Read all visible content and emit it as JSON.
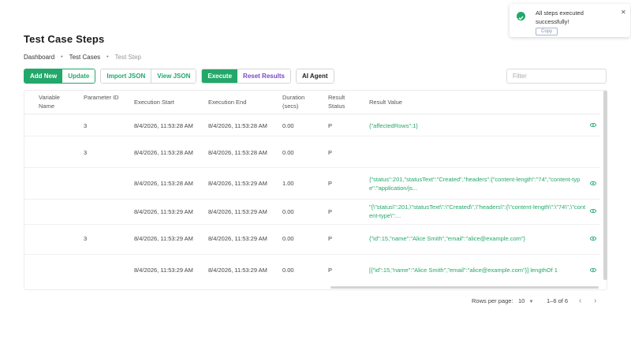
{
  "page": {
    "title": "Test Case Steps"
  },
  "breadcrumb": {
    "items": [
      "Dashboard",
      "Test Cases",
      "Test Step"
    ]
  },
  "toolbar": {
    "add_new": "Add New",
    "update": "Update",
    "import_json": "Import JSON",
    "view_json": "View JSON",
    "execute": "Execute",
    "reset_results": "Reset Results",
    "ai_agent": "AI Agent"
  },
  "filter": {
    "placeholder": "Filter",
    "value": ""
  },
  "table": {
    "headers": {
      "variable_name": "Variable Name",
      "parameter_id": "Parameter ID",
      "execution_start": "Execution Start",
      "execution_end": "Execution End",
      "duration": "Duration (secs)",
      "result_status": "Result Status",
      "result_value": "Result Value"
    },
    "rows": [
      {
        "parameter_id": "3",
        "execution_start": "8/4/2026, 11:53:28 AM",
        "execution_end": "8/4/2026, 11:53:28 AM",
        "duration": "0.00",
        "status": "P",
        "result": "{\"affectedRows\":1}",
        "has_view": true
      },
      {
        "parameter_id": "3",
        "execution_start": "8/4/2026, 11:53:28 AM",
        "execution_end": "8/4/2026, 11:53:28 AM",
        "duration": "0.00",
        "status": "P",
        "result": "",
        "has_view": false
      },
      {
        "parameter_id": "",
        "execution_start": "8/4/2026, 11:53:28 AM",
        "execution_end": "8/4/2026, 11:53:29 AM",
        "duration": "1.00",
        "status": "P",
        "result": "{\"status\":201,\"statusText\":\"Created\",\"headers\":{\"content-length\":\"74\",\"content-type\":\"application/js...",
        "has_view": true
      },
      {
        "parameter_id": "",
        "execution_start": "8/4/2026, 11:53:29 AM",
        "execution_end": "8/4/2026, 11:53:29 AM",
        "duration": "0.00",
        "status": "P",
        "result": "\"{\\\"status\\\":201,\\\"statusText\\\":\\\"Created\\\",\\\"headers\\\":{\\\"content-length\\\":\\\"74\\\",\\\"content-type\\\":...",
        "has_view": true
      },
      {
        "parameter_id": "3",
        "execution_start": "8/4/2026, 11:53:29 AM",
        "execution_end": "8/4/2026, 11:53:29 AM",
        "duration": "0.00",
        "status": "P",
        "result": "{\"id\":15,\"name\":\"Alice Smith\",\"email\":\"alice@example.com\"}",
        "has_view": true
      },
      {
        "parameter_id": "",
        "execution_start": "8/4/2026, 11:53:29 AM",
        "execution_end": "8/4/2026, 11:53:29 AM",
        "duration": "0.00",
        "status": "P",
        "result": "[{\"id\":15,\"name\":\"Alice Smith\",\"email\":\"alice@example.com\"}] lengthOf 1",
        "has_view": true
      }
    ]
  },
  "pagination": {
    "rows_per_page_label": "Rows per page:",
    "rows_per_page": "10",
    "range": "1–6 of 6"
  },
  "toast": {
    "message": "All steps executed successfully!",
    "copy_label": "Copy"
  },
  "colors": {
    "accent": "#22a86a",
    "purple": "#7b46c7"
  }
}
